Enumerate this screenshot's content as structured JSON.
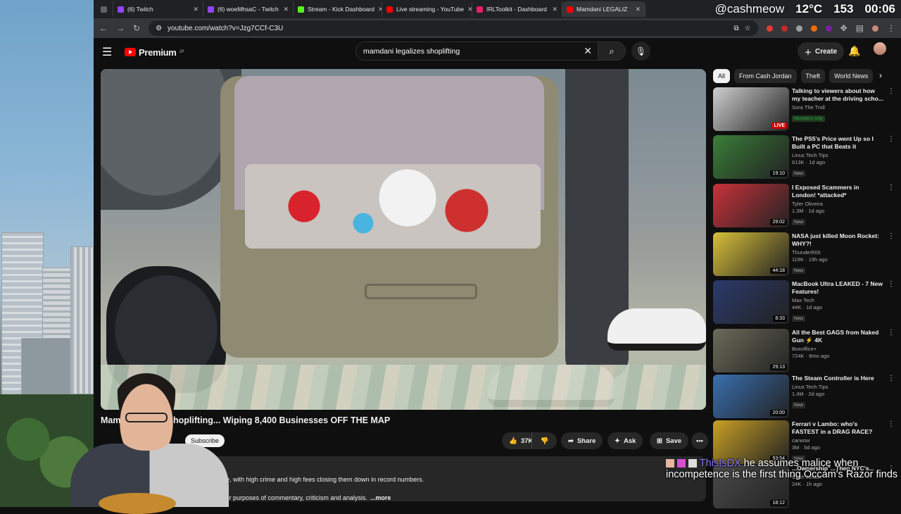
{
  "tabs": [
    {
      "label": "(6) Twitch",
      "color": "#9146ff"
    },
    {
      "label": "(6) woeMhsaC - Twitch",
      "color": "#9146ff"
    },
    {
      "label": "Stream - Kick Dashboard",
      "color": "#53fc18"
    },
    {
      "label": "Live streaming - YouTube",
      "color": "#ff0000"
    },
    {
      "label": "IRLToolkit - Dashboard",
      "color": "#e91e63"
    },
    {
      "label": "Mamdani LEGALIZ",
      "color": "#ff0000"
    }
  ],
  "stream_overlay": {
    "handle": "@cashmeow",
    "temperature": "12°C",
    "viewers": "153",
    "clock": "00:06"
  },
  "address_bar": {
    "url": "youtube.com/watch?v=Jzg7CCf-C3U"
  },
  "youtube": {
    "logo_text": "Premium",
    "logo_region": "JP",
    "search_query": "mamdani legalizes shoplifting",
    "create_label": "Create"
  },
  "video": {
    "title": "Mam...ES Shoplifting... Wiping 8,400 Businesses OFF THE MAP",
    "title_prefix": "Mam",
    "title_rest": "ES Shoplifting... Wiping 8,400 Businesses OFF THE MAP",
    "subscribe_label": "Subscribe",
    "likes": "37K",
    "share_label": "Share",
    "ask_label": "Ask",
    "save_label": "Save",
    "description_line1": "re, with high crime and high fees closing them down in record numbers.",
    "description_line2": "for purposes of commentary, criticism and analysis.",
    "more_label": "...more"
  },
  "chips": [
    "All",
    "From Cash Jordan",
    "Theft",
    "World News"
  ],
  "recommendations": [
    {
      "title": "Talking to viewers about how my teacher at the driving scho...",
      "channel": "Sora The Troll",
      "meta": "",
      "badge": "Members only",
      "badge_type": "members",
      "overlay": "LIVE",
      "overlay_type": "live",
      "thumb": "#cfcfcf"
    },
    {
      "title": "The PS5's Price went Up so I Built a PC that Beats it",
      "channel": "Linus Tech Tips",
      "meta": "613K · 1d ago",
      "badge": "New",
      "badge_type": "new",
      "overlay": "19:10",
      "overlay_type": "dur",
      "thumb": "#3a7d3a"
    },
    {
      "title": "I Exposed Scammers in London! *attacked*",
      "channel": "Tyler Oliveira",
      "meta": "1.3M · 1d ago",
      "badge": "New",
      "badge_type": "new",
      "overlay": "29:02",
      "overlay_type": "dur",
      "thumb": "#c8323a"
    },
    {
      "title": "NASA just killed Moon Rocket: WHY?!",
      "channel": "Thunderf00t",
      "meta": "119K · 19h ago",
      "badge": "New",
      "badge_type": "new",
      "overlay": "44:18",
      "overlay_type": "dur",
      "thumb": "#d8c13a"
    },
    {
      "title": "MacBook Ultra LEAKED - 7 New Features!",
      "channel": "Max Tech",
      "meta": "44K · 1d ago",
      "badge": "New",
      "badge_type": "new",
      "overlay": "8:33",
      "overlay_type": "dur",
      "thumb": "#2b3a6b"
    },
    {
      "title": "All the Best GAGS from Naked Gun ⚡ 4K",
      "channel": "Boxoffice+",
      "meta": "724K · 8mo ago",
      "badge": "",
      "badge_type": "",
      "overlay": "29:13",
      "overlay_type": "dur",
      "thumb": "#6b6b5a"
    },
    {
      "title": "The Steam Controller is Here",
      "channel": "Linus Tech Tips",
      "meta": "1.4M · 2d ago",
      "badge": "New",
      "badge_type": "new",
      "overlay": "20:00",
      "overlay_type": "dur",
      "thumb": "#3a6fb0"
    },
    {
      "title": "Ferrari v Lambo: who's FASTEST in a DRAG RACE?",
      "channel": "carwow",
      "meta": "3M · 5d ago",
      "badge": "New",
      "badge_type": "new",
      "overlay": "53:54",
      "overlay_type": "dur",
      "thumb": "#c9a126"
    },
    {
      "title": "...Ownership\"...Then NYC's...",
      "channel": "Cash Jordan",
      "meta": "24K · 1h ago",
      "badge": "",
      "badge_type": "",
      "overlay": "18:12",
      "overlay_type": "dur",
      "thumb": "#4a4a4a"
    }
  ],
  "chat": {
    "user": "ThisIsDX",
    "message": "he assumes malice when incompetence is the first thing Occam's Razor finds"
  }
}
